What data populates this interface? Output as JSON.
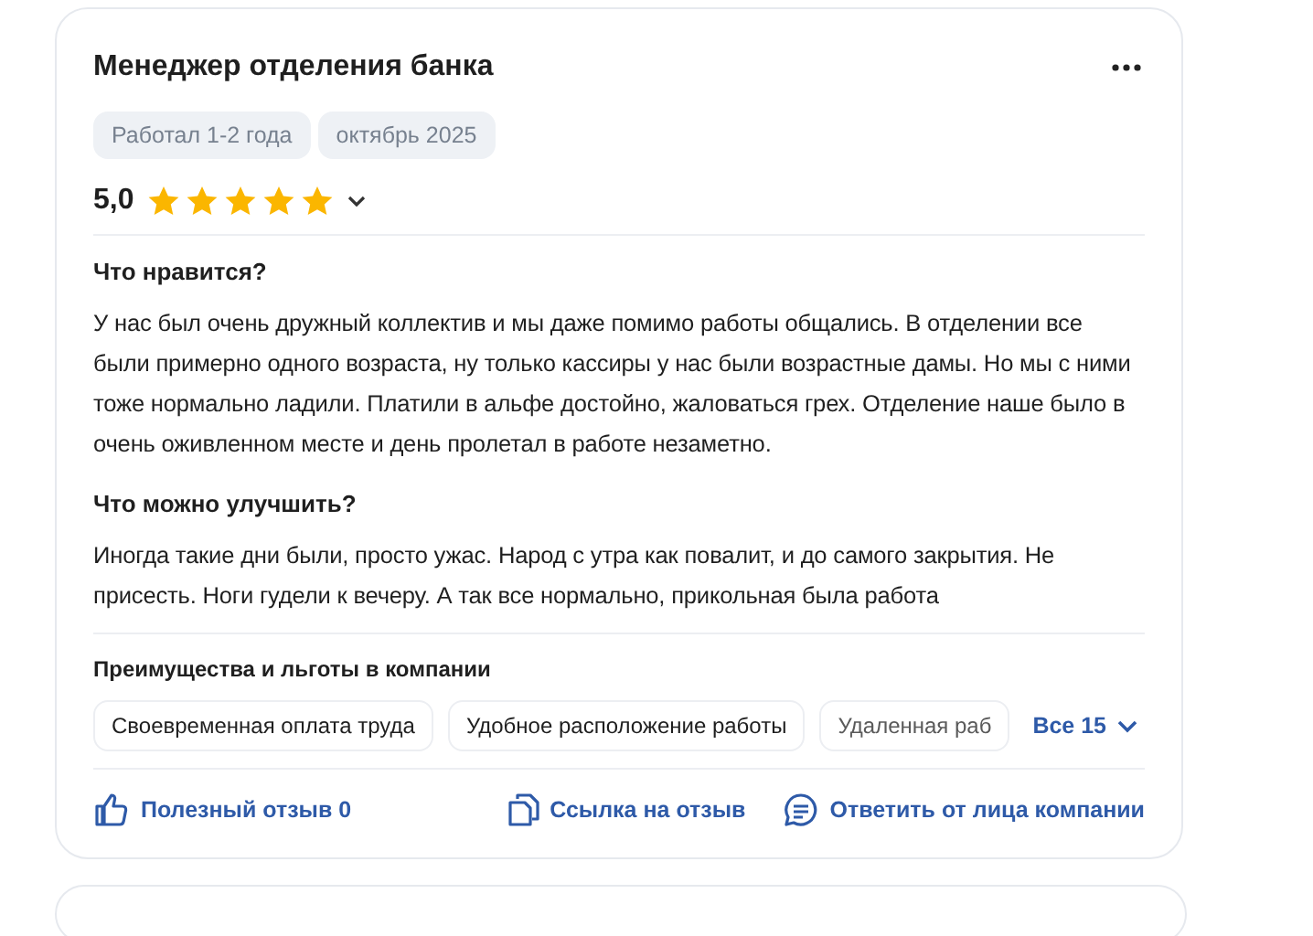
{
  "review": {
    "title": "Менеджер отделения банка",
    "tags": [
      "Работал 1-2 года",
      "октябрь 2025"
    ],
    "rating": "5,0",
    "stars": 5,
    "sections": [
      {
        "heading": "Что нравится?",
        "text": "У нас был очень дружный коллектив и мы даже помимо работы общались. В отделении все были примерно одного возраста, ну только кассиры у нас были возрастные дамы. Но мы с ними тоже нормально ладили. Платили в альфе достойно, жаловаться грех. Отделение наше было в очень оживленном месте и день пролетал в работе незаметно."
      },
      {
        "heading": "Что можно улучшить?",
        "text": "Иногда такие дни были, просто ужас. Народ с утра как повалит, и до самого закрытия. Не присесть. Ноги гудели к вечеру. А так все нормально, прикольная была работа"
      }
    ],
    "benefits": {
      "heading": "Преимущества и льготы в компании",
      "items": [
        "Своевременная оплата труда",
        "Удобное расположение работы",
        "Удаленная раб"
      ],
      "more": "Все 15"
    },
    "actions": [
      {
        "kind": "like",
        "label": "Полезный отзыв 0"
      },
      {
        "kind": "copy",
        "label": "Ссылка на отзыв"
      },
      {
        "kind": "reply",
        "label": "Ответить от лица компании"
      }
    ]
  }
}
